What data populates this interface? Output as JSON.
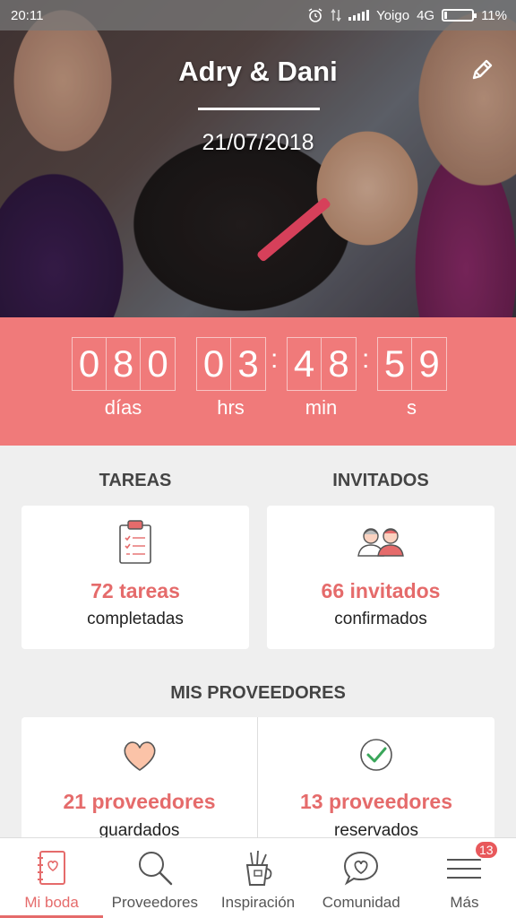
{
  "status_bar": {
    "time": "20:11",
    "carrier": "Yoigo",
    "network": "4G",
    "battery": "11%",
    "battery_level": 0.11
  },
  "hero": {
    "couple_name": "Adry & Dani",
    "wedding_date": "21/07/2018"
  },
  "countdown": {
    "days": [
      "0",
      "8",
      "0"
    ],
    "hours": [
      "0",
      "3"
    ],
    "minutes": [
      "4",
      "8"
    ],
    "seconds": [
      "5",
      "9"
    ],
    "separator": ":",
    "labels": {
      "days": "días",
      "hours": "hrs",
      "minutes": "min",
      "seconds": "s"
    }
  },
  "tasks": {
    "title": "TAREAS",
    "count_text": "72 tareas",
    "sub_text": "completadas"
  },
  "guests": {
    "title": "INVITADOS",
    "count_text": "66 invitados",
    "sub_text": "confirmados"
  },
  "providers": {
    "title": "MIS PROVEEDORES",
    "saved": {
      "count_text": "21 proveedores",
      "sub_text": "guardados"
    },
    "booked": {
      "count_text": "13 proveedores",
      "sub_text": "reservados"
    }
  },
  "bottom_nav": {
    "items": [
      {
        "label": "Mi boda",
        "icon": "notebook-icon",
        "active": true
      },
      {
        "label": "Proveedores",
        "icon": "search-icon",
        "active": false
      },
      {
        "label": "Inspiración",
        "icon": "pencil-cup-icon",
        "active": false
      },
      {
        "label": "Comunidad",
        "icon": "chat-heart-icon",
        "active": false
      },
      {
        "label": "Más",
        "icon": "menu-icon",
        "active": false,
        "badge": "13"
      }
    ]
  },
  "colors": {
    "accent": "#f07a7a",
    "accent_text": "#e56b6b",
    "background": "#efefef"
  }
}
